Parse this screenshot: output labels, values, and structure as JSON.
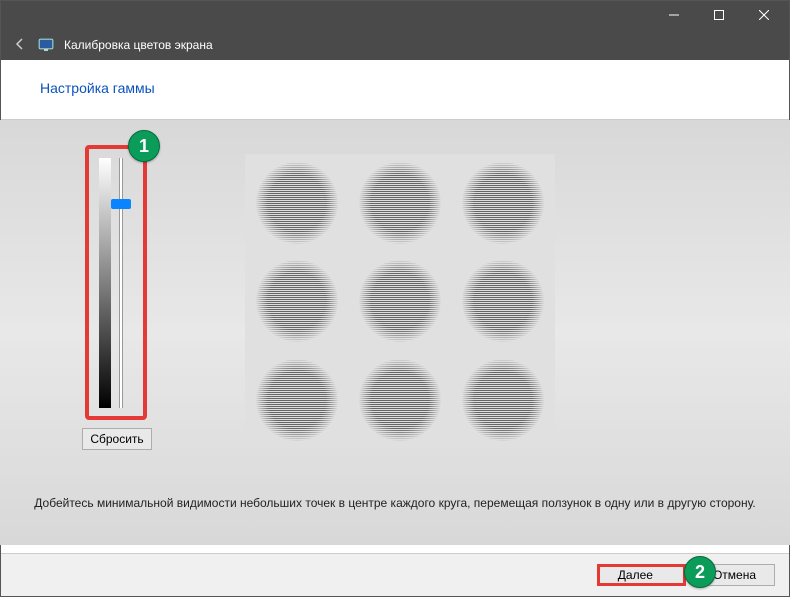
{
  "window": {
    "title": "Калибровка цветов экрана"
  },
  "page": {
    "heading": "Настройка гаммы",
    "instruction": "Добейтесь минимальной видимости небольших точек в центре каждого круга, перемещая ползунок в одну или в другую сторону."
  },
  "controls": {
    "reset": "Сбросить",
    "next": "Далее",
    "cancel": "Отмена"
  },
  "annotations": {
    "badge1": "1",
    "badge2": "2"
  },
  "slider": {
    "value": 80,
    "min": 0,
    "max": 100
  },
  "colors": {
    "accent_blue": "#0a52be",
    "badge_green": "#0b9c5a",
    "highlight_red": "#e53935"
  }
}
